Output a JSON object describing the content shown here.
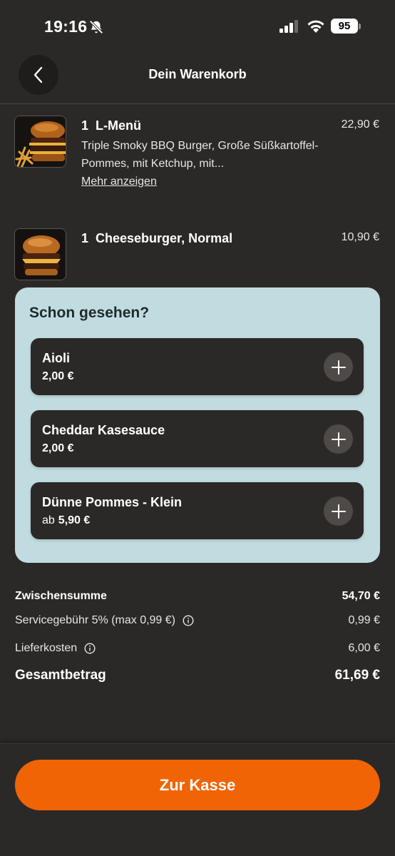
{
  "status_bar": {
    "time": "19:16",
    "battery": "95",
    "icons": [
      "bell-slash-icon",
      "signal-icon",
      "wifi-icon",
      "battery-icon"
    ]
  },
  "header": {
    "title": "Dein Warenkorb",
    "back_icon": "chevron-left-icon"
  },
  "cart": {
    "items": [
      {
        "qty": "1",
        "name": "L-Menü",
        "price": "22,90 €",
        "description": "Triple Smoky BBQ Burger, Große Süßkartoffel-Pommes, mit Ketchup, mit...",
        "more_label": "Mehr anzeigen"
      },
      {
        "qty": "1",
        "name": "Cheeseburger, Normal",
        "price": "10,90 €"
      }
    ]
  },
  "upsell": {
    "title": "Schon gesehen?",
    "items": [
      {
        "name": "Aioli",
        "price_prefix": "",
        "price": "2,00 €"
      },
      {
        "name": "Cheddar Kasesauce",
        "price_prefix": "",
        "price": "2,00 €"
      },
      {
        "name": "Dünne Pommes - Klein",
        "price_prefix": "ab",
        "price": "5,90 €"
      }
    ],
    "add_icon": "plus-icon"
  },
  "summary": {
    "subtotal_label": "Zwischensumme",
    "subtotal_value": "54,70 €",
    "service_label": "Servicegebühr 5% (max 0,99 €)",
    "service_value": "0,99 €",
    "delivery_label": "Lieferkosten",
    "delivery_value": "6,00 €",
    "total_label": "Gesamtbetrag",
    "total_value": "61,69 €"
  },
  "checkout": {
    "label": "Zur Kasse"
  },
  "colors": {
    "background": "#2b2927",
    "accent": "#f06405",
    "upsell_panel": "#c1dce0"
  }
}
